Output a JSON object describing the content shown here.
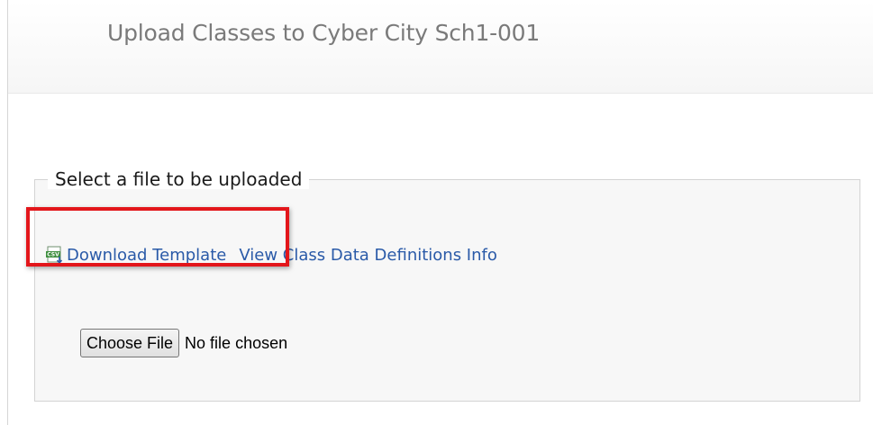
{
  "header": {
    "title": "Upload Classes to Cyber City Sch1-001"
  },
  "upload": {
    "legend": "Select a file to be uploaded",
    "download_icon": "csv-file-icon",
    "download_template_label": "Download Template",
    "view_definitions_label": "View Class Data Definitions Info",
    "choose_file_label": "Choose File",
    "file_status": "No file chosen"
  },
  "colors": {
    "link": "#2a5aa8",
    "highlight": "#e3161b",
    "title": "#7a7a7a",
    "panel_background": "#f7f7f7"
  }
}
